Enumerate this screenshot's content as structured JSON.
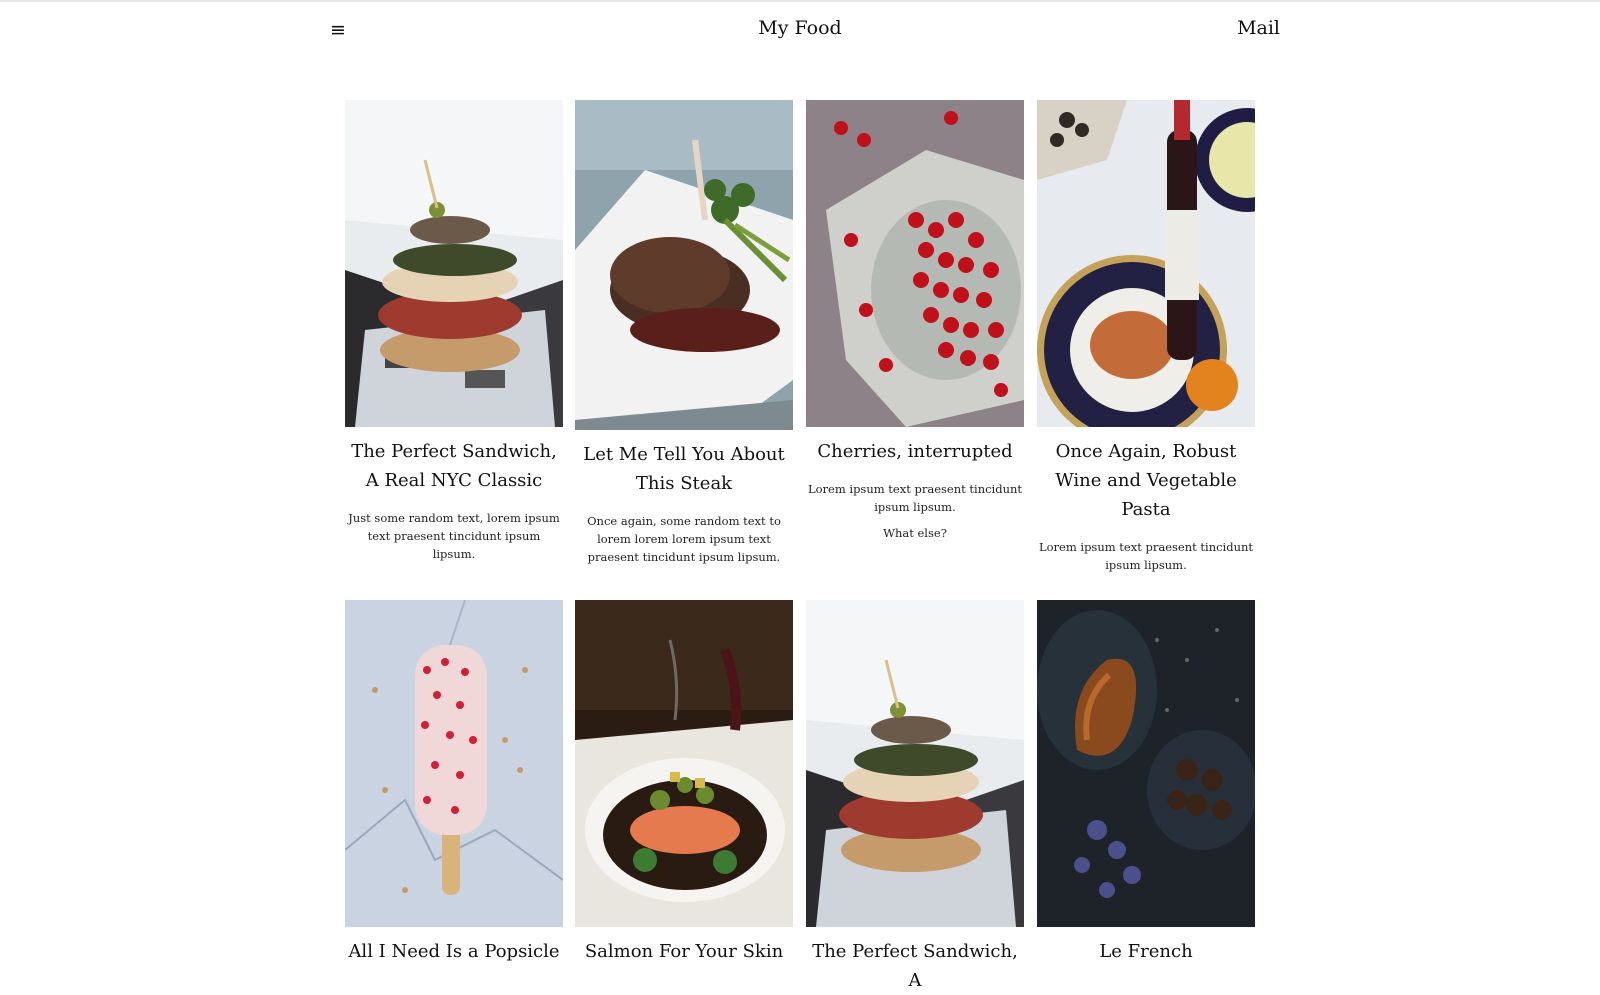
{
  "header": {
    "brand": "My Food",
    "mail_label": "Mail",
    "menu_icon": "hamburger-icon"
  },
  "posts": [
    {
      "title": "The Perfect Sandwich, A Real NYC Classic",
      "text": "Just some random text, lorem ipsum text praesent tincidunt ipsum lipsum.",
      "image": "sandwich"
    },
    {
      "title": "Let Me Tell You About This Steak",
      "text": "Once again, some random text to lorem lorem lorem ipsum text praesent tincidunt ipsum lipsum.",
      "image": "steak"
    },
    {
      "title": "Cherries, interrupted",
      "text": "Lorem ipsum text praesent tincidunt ipsum lipsum.",
      "extra": "What else?",
      "image": "cherries"
    },
    {
      "title": "Once Again, Robust Wine and Vegetable Pasta",
      "text": "Lorem ipsum text praesent tincidunt ipsum lipsum.",
      "image": "wine-pasta"
    },
    {
      "title": "All I Need Is a Popsicle",
      "image": "popsicle"
    },
    {
      "title": "Salmon For Your Skin",
      "image": "salmon"
    },
    {
      "title": "The Perfect Sandwich, A",
      "image": "sandwich"
    },
    {
      "title": "Le French",
      "image": "croissant"
    }
  ]
}
